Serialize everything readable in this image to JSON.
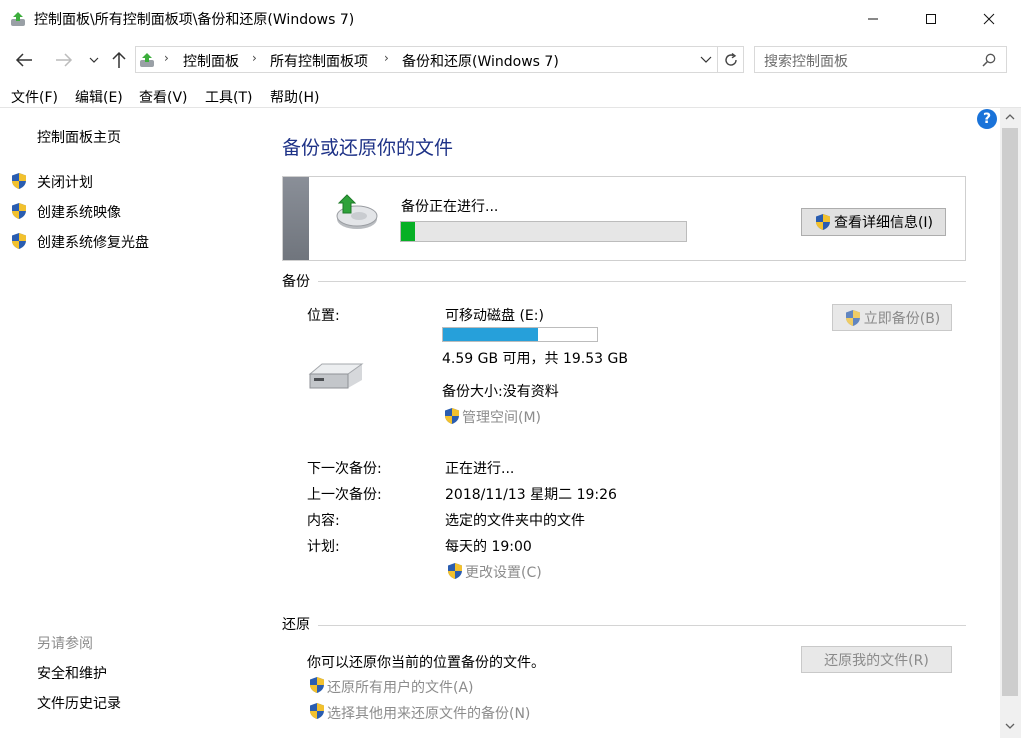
{
  "window": {
    "title": "控制面板\\所有控制面板项\\备份和还原(Windows 7)"
  },
  "address": {
    "crumbs": [
      "控制面板",
      "所有控制面板项",
      "备份和还原(Windows 7)"
    ]
  },
  "search": {
    "placeholder": "搜索控制面板"
  },
  "menu": {
    "file": "文件(F)",
    "edit": "编辑(E)",
    "view": "查看(V)",
    "tools": "工具(T)",
    "help": "帮助(H)"
  },
  "sidebar": {
    "home": "控制面板主页",
    "items": [
      "关闭计划",
      "创建系统映像",
      "创建系统修复光盘"
    ],
    "see_also_title": "另请参阅",
    "see_also": [
      "安全和维护",
      "文件历史记录"
    ]
  },
  "main": {
    "title": "备份或还原你的文件",
    "progress": {
      "text": "备份正在进行...",
      "fraction": 0.05,
      "details_button": "查看详细信息(I)"
    },
    "backup": {
      "section": "备份",
      "location_label": "位置:",
      "drive_name": "可移动磁盘 (E:)",
      "drive_used_fraction": 0.62,
      "drive_space": "4.59 GB 可用，共 19.53 GB",
      "backup_size": "备份大小:没有资料",
      "manage_space": "管理空间(M)",
      "backup_now": "立即备份(B)",
      "next_label": "下一次备份:",
      "next_value": "正在进行...",
      "last_label": "上一次备份:",
      "last_value": "2018/11/13 星期二 19:26",
      "content_label": "内容:",
      "content_value": "选定的文件夹中的文件",
      "schedule_label": "计划:",
      "schedule_value": "每天的 19:00",
      "change_settings": "更改设置(C)"
    },
    "restore": {
      "section": "还原",
      "description": "你可以还原你当前的位置备份的文件。",
      "restore_my_files": "还原我的文件(R)",
      "restore_all_users": "还原所有用户的文件(A)",
      "select_other": "选择其他用来还原文件的备份(N)"
    }
  },
  "colors": {
    "title_blue": "#1e3287",
    "progress_green": "#06b025",
    "drive_bar_blue": "#26a0da",
    "help_blue": "#1a73d9"
  }
}
